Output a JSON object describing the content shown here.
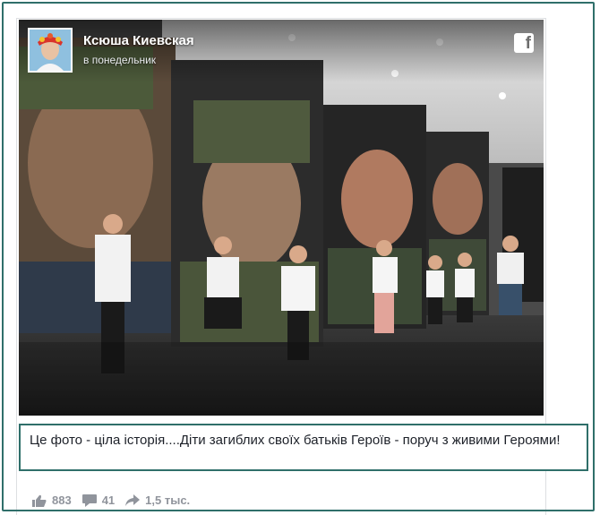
{
  "post": {
    "author_name": "Ксюша Киевская",
    "time": "в понедельник",
    "caption": "Це фото - ціла історія....Діти загиблих своїх батьків Героїв - поруч з живими Героями!",
    "platform_icon": "facebook-icon",
    "avatar_icon": "profile-photo"
  },
  "stats": {
    "likes": "883",
    "comments": "41",
    "shares": "1,5 тыс."
  },
  "colors": {
    "frame": "#2f6f6a",
    "text": "#1d2129",
    "muted": "#90949c"
  }
}
